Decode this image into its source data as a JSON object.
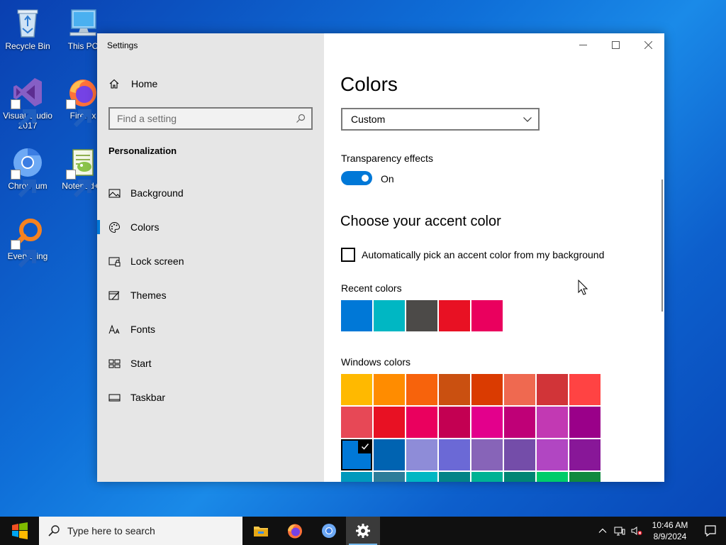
{
  "desktop": {
    "icons": [
      {
        "label": "Recycle Bin"
      },
      {
        "label": "This PC"
      },
      {
        "label": "Visual Studio 2017"
      },
      {
        "label": "Firefox"
      },
      {
        "label": "Chromium"
      },
      {
        "label": "Notepad++"
      },
      {
        "label": "Everything"
      }
    ]
  },
  "settings": {
    "app_title": "Settings",
    "home_label": "Home",
    "search_placeholder": "Find a setting",
    "section_title": "Personalization",
    "nav": [
      {
        "label": "Background",
        "icon": "picture-icon"
      },
      {
        "label": "Colors",
        "icon": "palette-icon",
        "active": true
      },
      {
        "label": "Lock screen",
        "icon": "lock-screen-icon"
      },
      {
        "label": "Themes",
        "icon": "themes-icon"
      },
      {
        "label": "Fonts",
        "icon": "fonts-icon"
      },
      {
        "label": "Start",
        "icon": "start-icon"
      },
      {
        "label": "Taskbar",
        "icon": "taskbar-icon"
      }
    ],
    "page_title": "Colors",
    "color_mode_value": "Custom",
    "transparency_label": "Transparency effects",
    "transparency_state": "On",
    "accent_heading": "Choose your accent color",
    "auto_accent_label": "Automatically pick an accent color from my background",
    "auto_accent_checked": false,
    "recent_colors_label": "Recent colors",
    "recent_colors": [
      "#0078d7",
      "#00b7c3",
      "#4c4a48",
      "#e81123",
      "#ea005e"
    ],
    "windows_colors_label": "Windows colors",
    "windows_colors": [
      "#ffb900",
      "#ff8c00",
      "#f7630c",
      "#ca5010",
      "#da3b01",
      "#ef6950",
      "#d13438",
      "#ff4343",
      "#e74856",
      "#e81123",
      "#ea005e",
      "#c30052",
      "#e3008c",
      "#bf0077",
      "#c239b3",
      "#9a0089",
      "#0078d7",
      "#0063b1",
      "#8e8cd8",
      "#6b69d6",
      "#8764b8",
      "#744da9",
      "#b146c2",
      "#881798",
      "#0099bc",
      "#2d7d9a",
      "#00b7c3",
      "#038387",
      "#00b294",
      "#018574",
      "#00cc6a",
      "#10893e"
    ],
    "selected_color": "#0078d7"
  },
  "taskbar": {
    "search_placeholder": "Type here to search",
    "time": "10:46 AM",
    "date": "8/9/2024"
  }
}
